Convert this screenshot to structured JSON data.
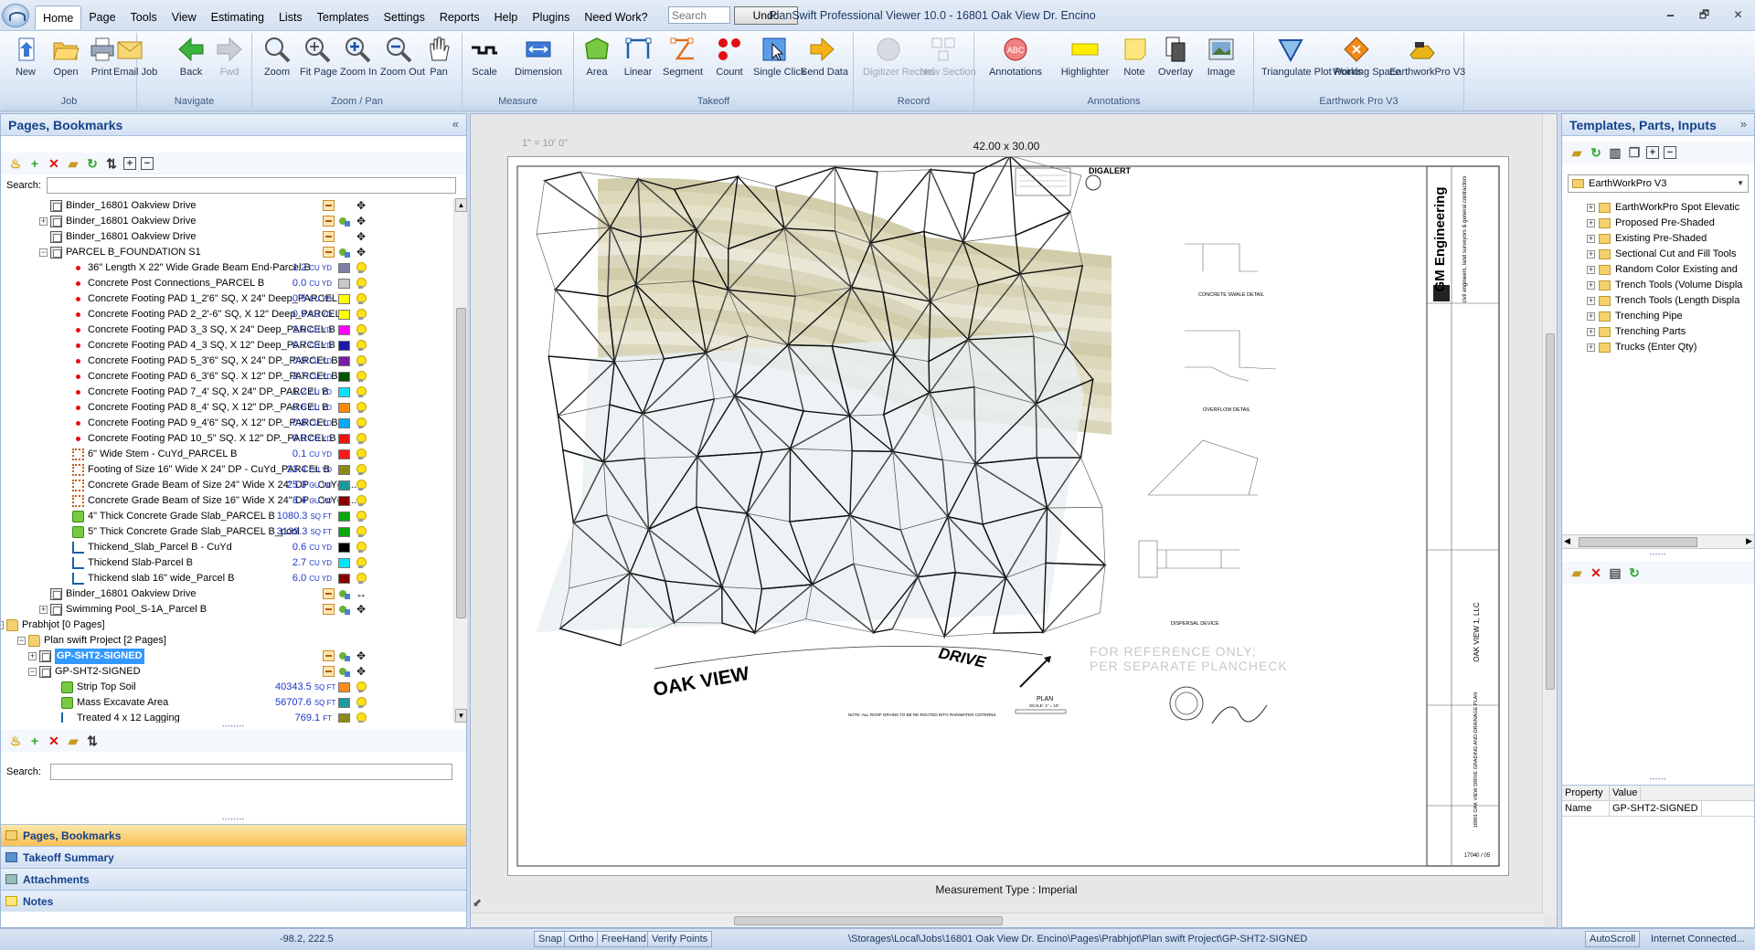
{
  "window": {
    "title": "PlanSwift Professional Viewer 10.0 - 16801 Oak View Dr. Encino",
    "minimize": "🗕",
    "maximize": "🗗",
    "close": "✕"
  },
  "menu": [
    "Home",
    "Page",
    "Tools",
    "View",
    "Estimating",
    "Lists",
    "Templates",
    "Settings",
    "Reports",
    "Help",
    "Plugins",
    "Need Work?"
  ],
  "search": {
    "placeholder": "Search",
    "value": ""
  },
  "undo_label": "Undo",
  "ribbon": {
    "groups": [
      {
        "label": "Job",
        "buttons": [
          "New",
          "Open",
          "Print",
          "Email Job"
        ]
      },
      {
        "label": "Navigate",
        "buttons": [
          "Back",
          "Fwd"
        ]
      },
      {
        "label": "Zoom / Pan",
        "buttons": [
          "Zoom",
          "Fit Page",
          "Zoom In",
          "Zoom Out",
          "Pan"
        ]
      },
      {
        "label": "Measure",
        "buttons": [
          "Scale",
          "Dimension"
        ]
      },
      {
        "label": "Takeoff",
        "buttons": [
          "Area",
          "Linear",
          "Segment",
          "Count",
          "Single Click",
          "Send Data"
        ]
      },
      {
        "label": "Record",
        "buttons": [
          "Digitizer Record",
          "New Section"
        ]
      },
      {
        "label": "Annotations",
        "buttons": [
          "Annotations",
          "Highlighter",
          "Note",
          "Overlay",
          "Image"
        ]
      },
      {
        "label": "Earthwork Pro V3",
        "buttons": [
          "Triangulate Plot Points",
          "Working Space",
          "EarthworkPro V3"
        ]
      }
    ]
  },
  "left_panel": {
    "title": "Pages, Bookmarks",
    "search_label": "Search:",
    "tree": [
      {
        "name": "Binder_16801 Oakview Drive",
        "icon": "page",
        "indent": 1
      },
      {
        "name": "Binder_16801 Oakview Drive",
        "icon": "page",
        "indent": 1,
        "expand": "+"
      },
      {
        "name": "Binder_16801 Oakview Drive",
        "icon": "page",
        "indent": 1
      },
      {
        "name": "PARCEL B_FOUNDATION S1",
        "icon": "page",
        "indent": 1,
        "expand": "−"
      },
      {
        "name": "36\" Length X 22\" Wide Grade Beam End-Parcel B",
        "icon": "count",
        "indent": 2,
        "value": "1.2",
        "unit": "CU YD",
        "color": "#7f7fa6"
      },
      {
        "name": "Concrete Post Connections_PARCEL B",
        "icon": "count",
        "indent": 2,
        "value": "0.0",
        "unit": "CU YD",
        "color": "#c8c8c8"
      },
      {
        "name": "Concrete Footing PAD 1_2'6\" SQ, X 24\" Deep_PARCEL B",
        "icon": "count",
        "indent": 2,
        "value": "0.5",
        "unit": "CU YD",
        "color": "#ffff00"
      },
      {
        "name": "Concrete Footing PAD 2_2'-6\" SQ, X 12\" Deep_PARCEL B",
        "icon": "count",
        "indent": 2,
        "value": "0.9",
        "unit": "CU YD",
        "color": "#ffff00"
      },
      {
        "name": "Concrete Footing PAD 3_3  SQ, X 24\" Deep_PARCEL B",
        "icon": "count",
        "indent": 2,
        "value": "2.0",
        "unit": "CU YD",
        "color": "#ff00ff"
      },
      {
        "name": "Concrete Footing PAD 4_3  SQ, X 12\" Deep_PARCEL B",
        "icon": "count",
        "indent": 2,
        "value": "0.7",
        "unit": "CU YD",
        "color": "#1a1aa8"
      },
      {
        "name": "Concrete Footing PAD 5_3'6\" SQ, X 24\" DP._PARCEL B",
        "icon": "count",
        "indent": 2,
        "value": "0.9",
        "unit": "CU YD",
        "color": "#7a1aa8"
      },
      {
        "name": "Concrete Footing PAD 6_3'6\" SQ. X 12\" DP._PARCEL B",
        "icon": "count",
        "indent": 2,
        "value": "2.7",
        "unit": "CU YD",
        "color": "#005500"
      },
      {
        "name": "Concrete Footing PAD 7_4' SQ, X 24\" DP._PARCEL B",
        "icon": "count",
        "indent": 2,
        "value": "1.2",
        "unit": "CU YD",
        "color": "#00e5ff"
      },
      {
        "name": "Concrete Footing PAD 8_4' SQ, X 12\" DP._PARCEL B",
        "icon": "count",
        "indent": 2,
        "value": "0.6",
        "unit": "CU YD",
        "color": "#ff8800"
      },
      {
        "name": "Concrete Footing PAD 9_4'6\" SQ, X 12\" DP._PARCEL B",
        "icon": "count",
        "indent": 2,
        "value": "0.8",
        "unit": "CU YD",
        "color": "#00aaff"
      },
      {
        "name": "Concrete Footing PAD 10_5\" SQ. X 12\" DP._PARCEL B",
        "icon": "count",
        "indent": 2,
        "value": "0.9",
        "unit": "CU YD",
        "color": "#ee1111"
      },
      {
        "name": "6\" Wide Stem - CuYd_PARCEL B",
        "icon": "linear",
        "indent": 2,
        "value": "0.1",
        "unit": "CU YD",
        "color": "#ff1a1a"
      },
      {
        "name": "Footing of Size 16\" Wide X 24\" DP - CuYd_PARCEL B",
        "icon": "linear",
        "indent": 2,
        "value": "23.4",
        "unit": "CU YD",
        "color": "#8a8a1a"
      },
      {
        "name": "Concrete Grade Beam of Size 24\" Wide X 24\" DP - CuYd_...",
        "icon": "linear",
        "indent": 2,
        "value": "25.3",
        "unit": "CU YD",
        "color": "#1a9a9a"
      },
      {
        "name": "Concrete Grade Beam of Size 16\" Wide X 24\" DP - CuYd_...",
        "icon": "linear",
        "indent": 2,
        "value": "8.4",
        "unit": "CU YD",
        "color": "#8a0000"
      },
      {
        "name": "4\" Thick Concrete Grade Slab_PARCEL B",
        "icon": "area",
        "indent": 2,
        "value": "1080.3",
        "unit": "SQ FT",
        "color": "#0aa80a"
      },
      {
        "name": "5\" Thick Concrete Grade Slab_PARCEL B_pool",
        "icon": "area",
        "indent": 2,
        "value": "3139.3",
        "unit": "SQ FT",
        "color": "#0aa80a"
      },
      {
        "name": "Thickend_Slab_Parcel B - CuYd",
        "icon": "seg",
        "indent": 2,
        "value": "0.6",
        "unit": "CU YD",
        "color": "#000000"
      },
      {
        "name": "Thickend Slab-Parcel B",
        "icon": "seg",
        "indent": 2,
        "value": "2.7",
        "unit": "CU YD",
        "color": "#00e5ff"
      },
      {
        "name": "Thickend slab 16\" wide_Parcel B",
        "icon": "seg",
        "indent": 2,
        "value": "6.0",
        "unit": "CU YD",
        "color": "#8a0000"
      },
      {
        "name": "Binder_16801 Oakview Drive",
        "icon": "page",
        "indent": 1
      },
      {
        "name": "Swimming Pool_S-1A_Parcel B",
        "icon": "page",
        "indent": 1,
        "expand": "+"
      },
      {
        "name": "Prabhjot [0 Pages]",
        "icon": "folder",
        "indent": -1,
        "expand": "−"
      },
      {
        "name": "Plan swift Project [2 Pages]",
        "icon": "folder",
        "indent": 0,
        "expand": "−"
      },
      {
        "name": "GP-SHT2-SIGNED",
        "icon": "page",
        "indent": 0.5,
        "expand": "+",
        "selected": true
      },
      {
        "name": "GP-SHT2-SIGNED",
        "icon": "page",
        "indent": 0.5,
        "expand": "−"
      },
      {
        "name": "Strip Top Soil",
        "icon": "area",
        "indent": 1.5,
        "value": "40343.5",
        "unit": "SQ FT",
        "color": "#ff8a1a"
      },
      {
        "name": "Mass Excavate Area",
        "icon": "area",
        "indent": 1.5,
        "value": "56707.6",
        "unit": "SQ FT",
        "color": "#1a9a9a"
      },
      {
        "name": "Treated 4 x 12 Lagging",
        "icon": "seg",
        "indent": 1.5,
        "value": "769.1",
        "unit": "FT",
        "color": "#8a8a1a"
      }
    ],
    "lower_search_label": "Search:",
    "nav": [
      "Pages, Bookmarks",
      "Takeoff Summary",
      "Attachments",
      "Notes"
    ]
  },
  "canvas": {
    "scale_label": "1\" = 10' 0\"",
    "size_label": "42.00 x 30.00",
    "measurement_type": "Measurement Type : Imperial",
    "street_left": "OAK   VIEW",
    "street_right": "DRIVE",
    "reference_note_1": "FOR  REFERENCE  ONLY;",
    "reference_note_2": "PER  SEPARATE  PLANCHECK",
    "company": "GM  Engineering",
    "company_sub": "civil engineers, land surveyors & general contractors",
    "owner": "OAK  VIEW 1,  LLC",
    "sheet_title": "16801 OAK VIEW DRIVE GRADING AND DRAINAGE PLAN",
    "detail_1": "CONCRETE SWALE DETAIL",
    "detail_2": "OVERFLOW  DETAIL",
    "detail_3": "DISPERSAL DEVICE",
    "digalert": "DIGALERT",
    "plan_label": "PLAN",
    "plan_scale": "SCALE: 1\" = 10'",
    "note_bottom": "NOTE:  ALL ROOF DRAINS TO BE RE-ROUTED INTO RAINWATER CISTERNS.",
    "sheet_number": "17040 / 05"
  },
  "right_panel": {
    "title": "Templates, Parts, Inputs",
    "selected_template": "EarthWorkPro V3",
    "tree": [
      "EarthWorkPro Spot Elevatic",
      "Proposed Pre-Shaded",
      "Existing Pre-Shaded",
      "Sectional Cut and Fill Tools",
      "Random Color Existing and",
      "Trench Tools (Volume Displa",
      "Trench Tools (Length Displa",
      "Trenching Pipe",
      "Trenching Parts",
      "Trucks (Enter Qty)"
    ],
    "props_header": [
      "Property",
      "Value"
    ],
    "props": [
      {
        "k": "Name",
        "v": "GP-SHT2-SIGNED"
      }
    ]
  },
  "status": {
    "coords": "-98.2, 222.5",
    "buttons": [
      "Snap",
      "Ortho",
      "FreeHand",
      "Verify Points"
    ],
    "path": "\\Storages\\Local\\Jobs\\16801 Oak View Dr. Encino\\Pages\\Prabhjot\\Plan swift Project\\GP-SHT2-SIGNED",
    "autoscroll": "AutoScroll",
    "internet": "Internet Connected..."
  }
}
